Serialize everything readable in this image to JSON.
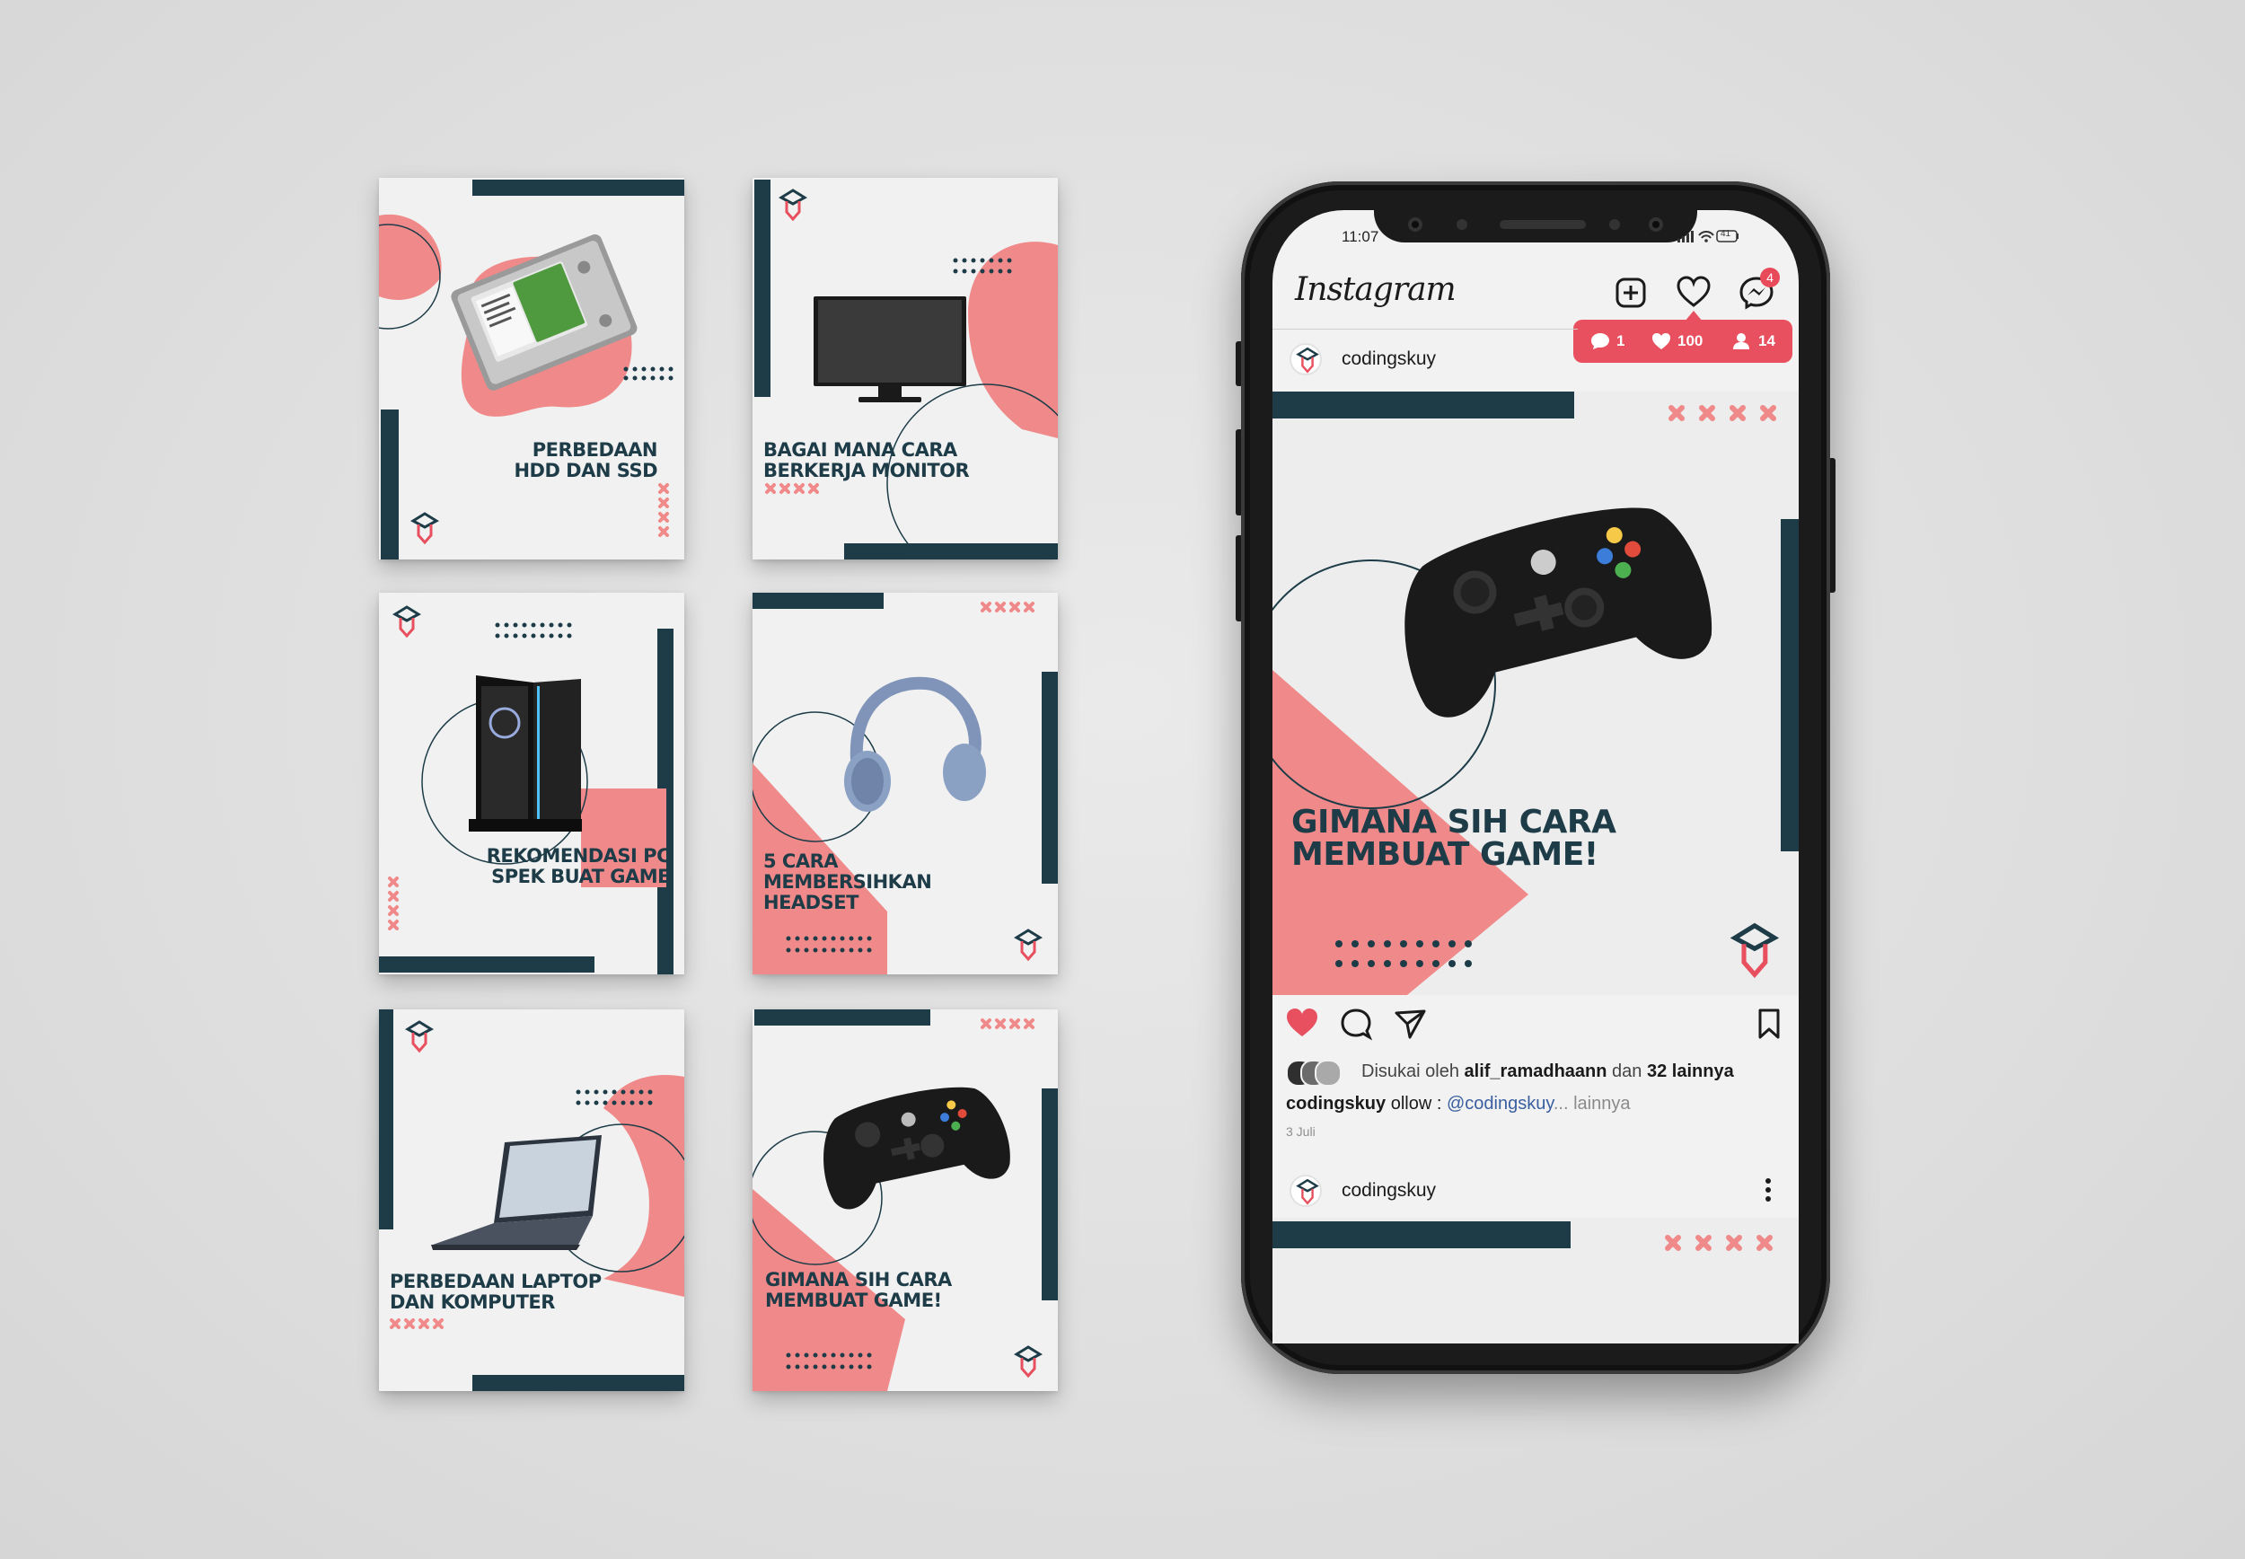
{
  "cards": [
    {
      "id": "hdd",
      "title_lines": [
        "PERBEDAAN",
        "HDD DAN SSD"
      ]
    },
    {
      "id": "monitor",
      "title_lines": [
        "BAGAI MANA CARA",
        "BERKERJA MONITOR"
      ]
    },
    {
      "id": "pc",
      "title_lines": [
        "REKOMENDASI PC",
        "SPEK BUAT GAME"
      ]
    },
    {
      "id": "headset",
      "title_lines": [
        "5 CARA",
        "MEMBERSIHKAN",
        "HEADSET"
      ]
    },
    {
      "id": "laptop",
      "title_lines": [
        "PERBEDAAN LAPTOP",
        "DAN KOMPUTER"
      ]
    },
    {
      "id": "gamepad",
      "title_lines": [
        "GIMANA SIH CARA",
        "MEMBUAT GAME!"
      ]
    }
  ],
  "phone": {
    "status_time": "11:07",
    "battery": "41",
    "app_name": "Instagram",
    "messenger_badge": "4",
    "notifications": {
      "comments": "1",
      "likes": "100",
      "followers": "14"
    },
    "post": {
      "username": "codingskuy",
      "title_lines": [
        "GIMANA SIH CARA",
        "MEMBUAT GAME!"
      ],
      "liked_by_prefix": "Disukai oleh",
      "liked_by_user": "alif_ramadhaann",
      "liked_by_suffix_a": "dan",
      "liked_by_count": "32 lainnya",
      "caption_user": "codingskuy",
      "caption_text": "ollow :",
      "caption_link": "@codingskuy",
      "caption_more": "... lainnya",
      "date": "3 Juli"
    },
    "next_post": {
      "username": "codingskuy"
    }
  },
  "colors": {
    "navy": "#1d3c48",
    "coral": "#f08a8a",
    "card_bg": "#f1f1f1",
    "red": "#e8505f"
  }
}
